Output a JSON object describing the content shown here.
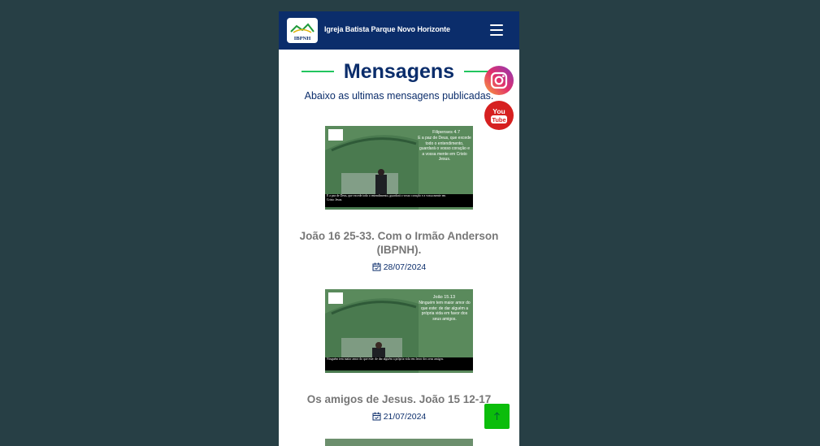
{
  "header": {
    "title": "Igreja Batista Parque Novo Horizonte",
    "logo_text": "IBPNH"
  },
  "section": {
    "heading": "Mensagens",
    "subtitle": "Abaixo as ultimas mensagens publicadas."
  },
  "messages": [
    {
      "title": "João 16 25-33. Com o Irmão Anderson (IBPNH).",
      "date": "28/07/2024",
      "thumb_ref": "Filipenses 4.7",
      "thumb_verse": "E a paz de Deus, que excede todo o entendimento, guardará o vosso coração e a vossa mente em Cristo Jesus.",
      "thumb_caption": "E a paz de Deus, que excede todo o entendimento, guardará o vosso coração e a vossa mente em Cristo Jesus."
    },
    {
      "title": "Os amigos de Jesus. João 15 12-17",
      "date": "21/07/2024",
      "thumb_ref": "João 15.13",
      "thumb_verse": "Ninguém tem maior amor do que este: de dar alguém a própria vida em favor dos seus amigos.",
      "thumb_caption": "Ninguém tem maior amor do que este: de dar alguém a própria vida em favor dos seus amigos."
    }
  ],
  "social": {
    "instagram": "instagram-icon",
    "youtube_line1": "You",
    "youtube_line2": "Tube"
  },
  "colors": {
    "navy": "#0b2d6b",
    "green": "#22c55e",
    "background": "#273f45",
    "button": "#0bbd0b"
  }
}
